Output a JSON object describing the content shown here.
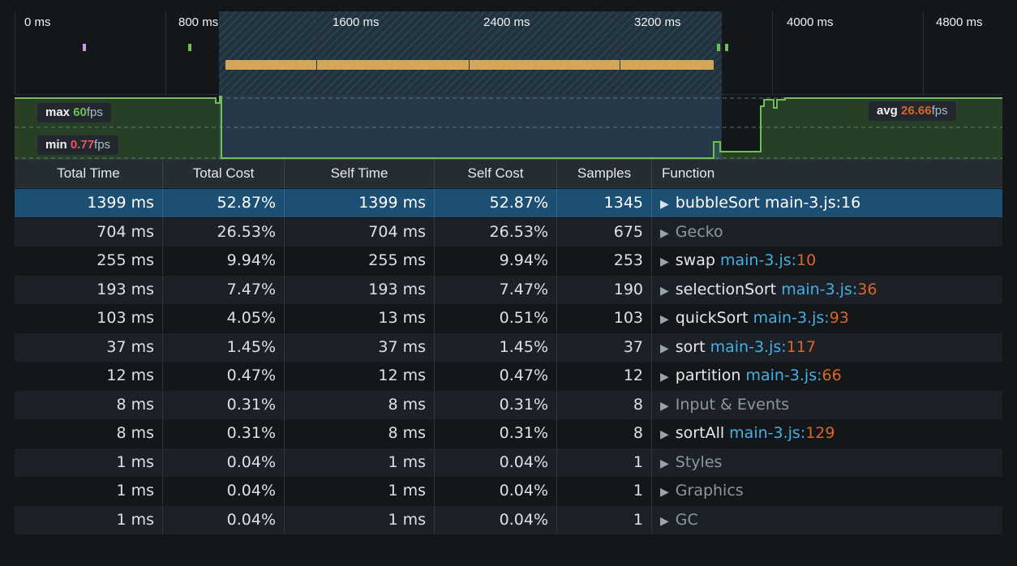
{
  "timeline": {
    "ticks": [
      "0 ms",
      "800 ms",
      "1600 ms",
      "2400 ms",
      "3200 ms",
      "4000 ms",
      "4800 ms"
    ]
  },
  "fps": {
    "max_label": "max",
    "max_value": "60",
    "min_label": "min",
    "min_value": "0.77",
    "avg_label": "avg",
    "avg_value": "26.66",
    "unit": "fps"
  },
  "table": {
    "headers": [
      "Total Time",
      "Total Cost",
      "Self Time",
      "Self Cost",
      "Samples",
      "Function"
    ],
    "rows": [
      {
        "total_time": "1399 ms",
        "total_cost": "52.87%",
        "self_time": "1399 ms",
        "self_cost": "52.87%",
        "samples": "1345",
        "name": "bubbleSort",
        "file": "main-3.js",
        "colon": ":",
        "line": "16",
        "kind": "js",
        "selected": true
      },
      {
        "total_time": "704 ms",
        "total_cost": "26.53%",
        "self_time": "704 ms",
        "self_cost": "26.53%",
        "samples": "675",
        "name": "Gecko",
        "kind": "platform"
      },
      {
        "total_time": "255 ms",
        "total_cost": "9.94%",
        "self_time": "255 ms",
        "self_cost": "9.94%",
        "samples": "253",
        "name": "swap",
        "file": "main-3.js",
        "colon": ":",
        "line": "10",
        "kind": "js"
      },
      {
        "total_time": "193 ms",
        "total_cost": "7.47%",
        "self_time": "193 ms",
        "self_cost": "7.47%",
        "samples": "190",
        "name": "selectionSort",
        "file": "main-3.js",
        "colon": ":",
        "line": "36",
        "kind": "js"
      },
      {
        "total_time": "103 ms",
        "total_cost": "4.05%",
        "self_time": "13 ms",
        "self_cost": "0.51%",
        "samples": "103",
        "name": "quickSort",
        "file": "main-3.js",
        "colon": ":",
        "line": "93",
        "kind": "js"
      },
      {
        "total_time": "37 ms",
        "total_cost": "1.45%",
        "self_time": "37 ms",
        "self_cost": "1.45%",
        "samples": "37",
        "name": "sort",
        "file": "main-3.js",
        "colon": ":",
        "line": "117",
        "kind": "js"
      },
      {
        "total_time": "12 ms",
        "total_cost": "0.47%",
        "self_time": "12 ms",
        "self_cost": "0.47%",
        "samples": "12",
        "name": "partition",
        "file": "main-3.js",
        "colon": ":",
        "line": "66",
        "kind": "js"
      },
      {
        "total_time": "8 ms",
        "total_cost": "0.31%",
        "self_time": "8 ms",
        "self_cost": "0.31%",
        "samples": "8",
        "name": "Input & Events",
        "kind": "platform"
      },
      {
        "total_time": "8 ms",
        "total_cost": "0.31%",
        "self_time": "8 ms",
        "self_cost": "0.31%",
        "samples": "8",
        "name": "sortAll",
        "file": "main-3.js",
        "colon": ":",
        "line": "129",
        "kind": "js"
      },
      {
        "total_time": "1 ms",
        "total_cost": "0.04%",
        "self_time": "1 ms",
        "self_cost": "0.04%",
        "samples": "1",
        "name": "Styles",
        "kind": "platform"
      },
      {
        "total_time": "1 ms",
        "total_cost": "0.04%",
        "self_time": "1 ms",
        "self_cost": "0.04%",
        "samples": "1",
        "name": "Graphics",
        "kind": "platform"
      },
      {
        "total_time": "1 ms",
        "total_cost": "0.04%",
        "self_time": "1 ms",
        "self_cost": "0.04%",
        "samples": "1",
        "name": "GC",
        "kind": "platform"
      }
    ]
  },
  "icons": {
    "expand": "triangle-right-icon"
  },
  "colors": {
    "background": "#14171a",
    "selection": "#1d4f73",
    "file_link": "#46afe3",
    "line_number": "#d96629",
    "duration_bar": "#d4a658",
    "fps_line": "#70bf53",
    "min_fps": "#eb5368"
  }
}
